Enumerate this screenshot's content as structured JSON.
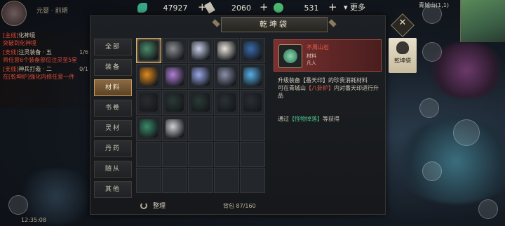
{
  "panel": {
    "title": "乾坤袋"
  },
  "currencies": [
    {
      "icon": "jade-icon",
      "value": "47927"
    },
    {
      "icon": "scroll-icon",
      "value": "2060"
    },
    {
      "icon": "coin-icon",
      "value": "531"
    }
  ],
  "more_label": "更多",
  "player": {
    "name": "元婴 · 前期"
  },
  "quests": [
    {
      "tag": "[主线]",
      "text": "化神境",
      "line2": "突破到化神境",
      "progress": ""
    },
    {
      "tag": "[支线]",
      "text": "注灵装备 · 五",
      "line2": "将任意6个装备部位注灵至5星",
      "progress": "1/6"
    },
    {
      "tag": "[支线]",
      "text": "神兵打造 · 二",
      "line2": "在[乾坤炉]强化内修任意一件",
      "progress": "0/1"
    }
  ],
  "categories": [
    "全部",
    "装备",
    "材料",
    "书卷",
    "灵材",
    "丹药",
    "随从",
    "其他"
  ],
  "active_category": "材料",
  "items": [
    {
      "name": "不周山石",
      "count": "",
      "color": "#4a8a6a",
      "selected": true
    },
    {
      "name": "material-2",
      "count": "",
      "color": "#8a8c90"
    },
    {
      "name": "material-3",
      "count": "",
      "color": "#c8d0e8"
    },
    {
      "name": "material-4",
      "count": "",
      "color": "#e8e4dc"
    },
    {
      "name": "material-5",
      "count": "",
      "color": "#3a6aa8"
    },
    {
      "name": "material-6",
      "count": "",
      "color": "#e08a20"
    },
    {
      "name": "material-7",
      "count": "",
      "color": "#b080d8"
    },
    {
      "name": "material-8",
      "count": "",
      "color": "#9aa8e8"
    },
    {
      "name": "material-9",
      "count": "",
      "color": "#8a90a8"
    },
    {
      "name": "material-10",
      "count": "",
      "color": "#58b0e8"
    },
    {
      "name": "material-11",
      "count": "",
      "color": "#2a2c30"
    },
    {
      "name": "material-12",
      "count": "",
      "color": "#2a3a36"
    },
    {
      "name": "material-13",
      "count": "",
      "color": "#2a3a36"
    },
    {
      "name": "material-14",
      "count": "",
      "color": "#2a3236"
    },
    {
      "name": "material-15",
      "count": "",
      "color": "#2a2e34"
    },
    {
      "name": "material-16",
      "count": "",
      "color": "#3a8a6a"
    },
    {
      "name": "material-17",
      "count": "",
      "color": "#cfd0d2"
    }
  ],
  "grid_total_slots": 30,
  "arrange_label": "整理",
  "capacity": "背包 87/160",
  "detail": {
    "name": "不周山石",
    "type": "材料",
    "quality": "凡人",
    "desc_pre": "升级装备【番天印】的珍贵消耗材料",
    "desc_line2_pre": "可在青城山",
    "desc_link": "【八卦炉】",
    "desc_line2_post": "内对番天印进行升品",
    "src_pre": "通过",
    "src_link": "【怪物掉落】",
    "src_post": "等获得"
  },
  "side_tab": {
    "label": "乾坤袋"
  },
  "minimap": {
    "label": "青城山(1,1)"
  },
  "clock": "12:35:08"
}
